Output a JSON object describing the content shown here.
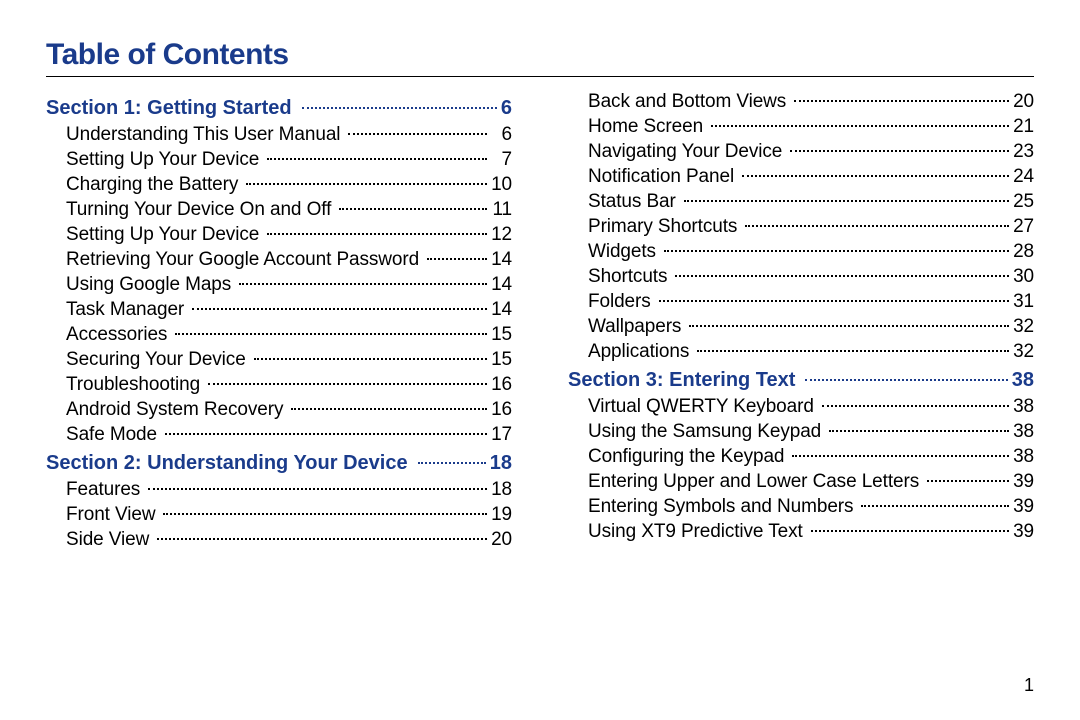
{
  "title": "Table of Contents",
  "footer_page": "1",
  "toc": [
    {
      "type": "section",
      "label": "Section 1:  Getting Started",
      "page": "6"
    },
    {
      "type": "item",
      "label": "Understanding This User Manual",
      "page": "6"
    },
    {
      "type": "item",
      "label": "Setting Up Your Device",
      "page": "7"
    },
    {
      "type": "item",
      "label": "Charging the Battery",
      "page": "10"
    },
    {
      "type": "item",
      "label": "Turning Your Device On and Off",
      "page": "11"
    },
    {
      "type": "item",
      "label": "Setting Up Your Device",
      "page": "12"
    },
    {
      "type": "item",
      "label": "Retrieving Your Google Account Password",
      "page": "14"
    },
    {
      "type": "item",
      "label": "Using Google Maps",
      "page": "14"
    },
    {
      "type": "item",
      "label": "Task Manager",
      "page": "14"
    },
    {
      "type": "item",
      "label": "Accessories",
      "page": "15"
    },
    {
      "type": "item",
      "label": "Securing Your Device",
      "page": "15"
    },
    {
      "type": "item",
      "label": "Troubleshooting",
      "page": "16"
    },
    {
      "type": "item",
      "label": "Android System Recovery",
      "page": "16"
    },
    {
      "type": "item",
      "label": "Safe Mode",
      "page": "17"
    },
    {
      "type": "section",
      "label": "Section 2:  Understanding Your Device",
      "page": "18"
    },
    {
      "type": "item",
      "label": "Features",
      "page": "18"
    },
    {
      "type": "item",
      "label": "Front View",
      "page": "19"
    },
    {
      "type": "item",
      "label": "Side View",
      "page": "20"
    },
    {
      "type": "item",
      "label": "Back and Bottom Views",
      "page": "20"
    },
    {
      "type": "item",
      "label": "Home Screen",
      "page": "21"
    },
    {
      "type": "item",
      "label": "Navigating Your Device",
      "page": "23"
    },
    {
      "type": "item",
      "label": "Notification Panel",
      "page": "24"
    },
    {
      "type": "item",
      "label": "Status Bar",
      "page": "25"
    },
    {
      "type": "item",
      "label": "Primary Shortcuts",
      "page": "27"
    },
    {
      "type": "item",
      "label": "Widgets",
      "page": "28"
    },
    {
      "type": "item",
      "label": "Shortcuts",
      "page": "30"
    },
    {
      "type": "item",
      "label": "Folders",
      "page": "31"
    },
    {
      "type": "item",
      "label": "Wallpapers",
      "page": "32"
    },
    {
      "type": "item",
      "label": "Applications",
      "page": "32"
    },
    {
      "type": "section",
      "label": "Section 3:  Entering Text",
      "page": "38"
    },
    {
      "type": "item",
      "label": "Virtual QWERTY Keyboard",
      "page": "38"
    },
    {
      "type": "item",
      "label": "Using the Samsung Keypad",
      "page": "38"
    },
    {
      "type": "item",
      "label": "Configuring the Keypad",
      "page": "38"
    },
    {
      "type": "item",
      "label": "Entering Upper and Lower Case Letters",
      "page": "39"
    },
    {
      "type": "item",
      "label": "Entering Symbols and Numbers",
      "page": "39"
    },
    {
      "type": "item",
      "label": "Using XT9 Predictive Text",
      "page": "39"
    }
  ]
}
